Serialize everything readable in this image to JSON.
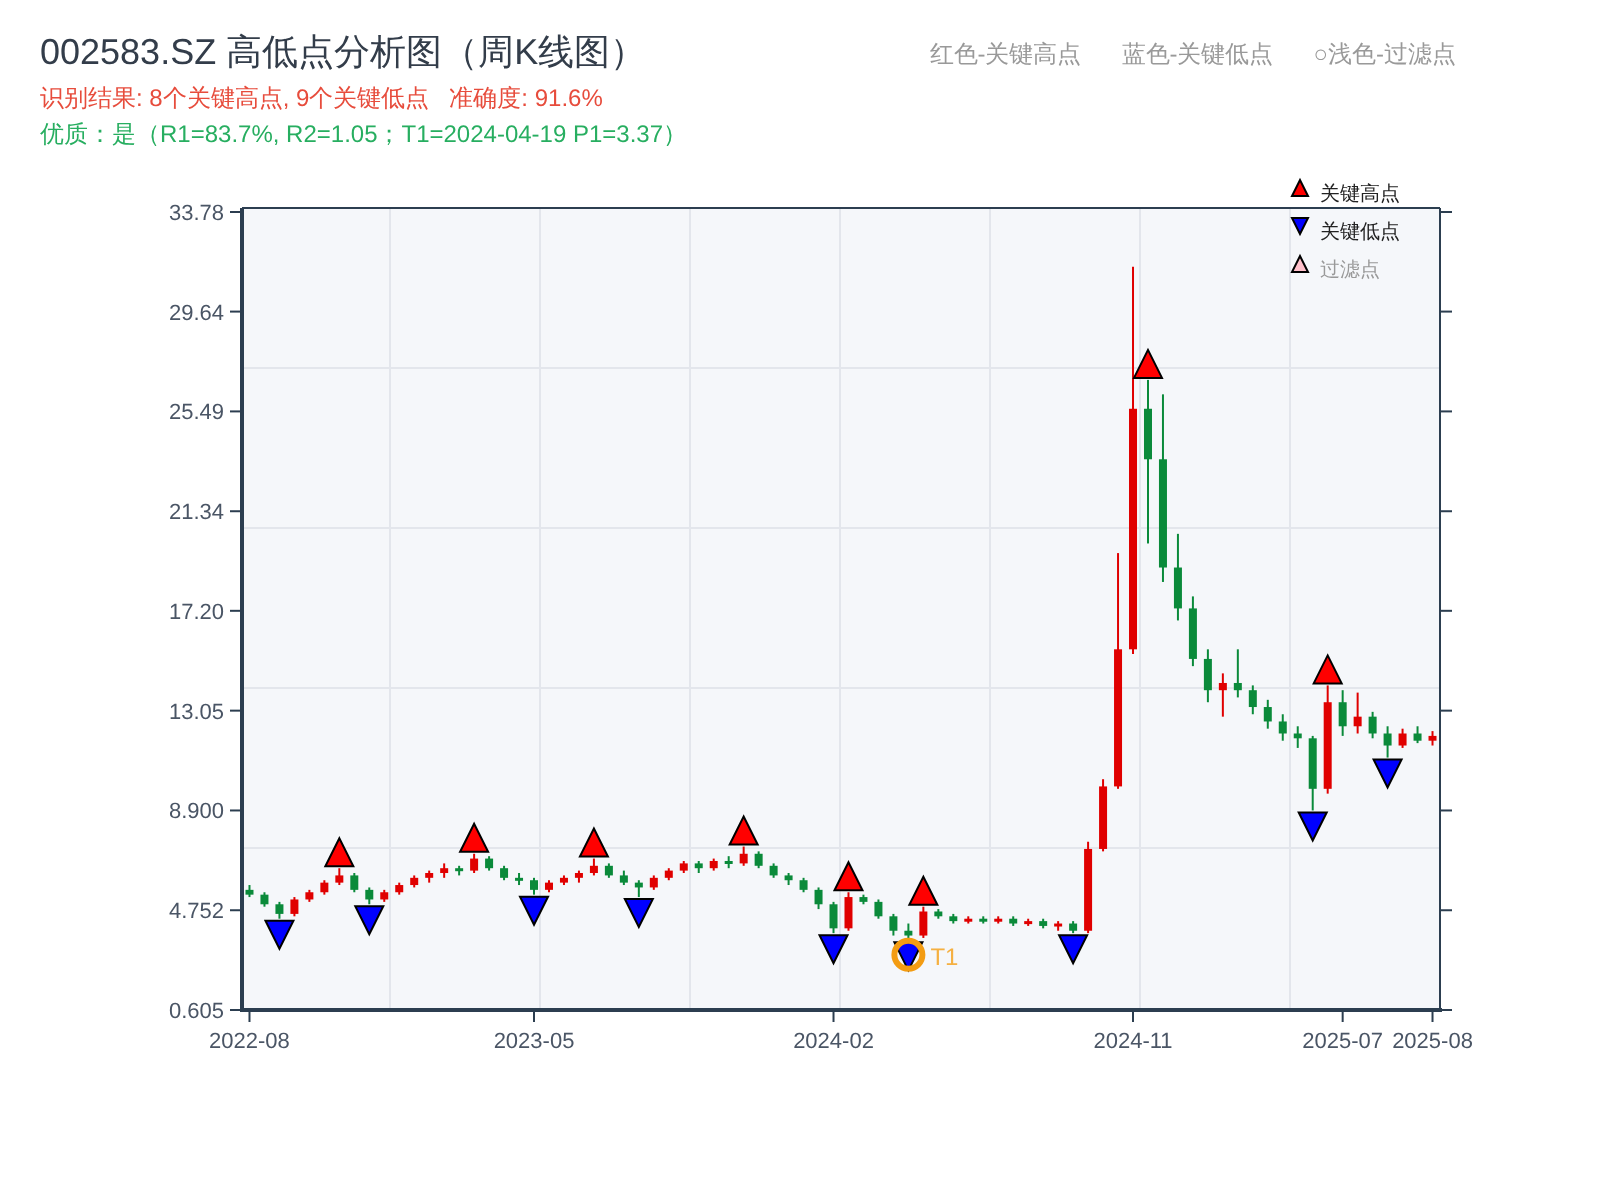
{
  "title": "002583.SZ 高低点分析图（周K线图）",
  "summary": "识别结果: 8个关键高点, 9个关键低点   准确度: 91.6%",
  "quality": "优质：是（R1=83.7%, R2=1.05；T1=2024-04-19 P1=3.37）",
  "color_key": [
    "红色-关键高点",
    "蓝色-关键低点",
    "○浅色-过滤点"
  ],
  "legend": [
    {
      "kind": "high",
      "label": "关键高点"
    },
    {
      "kind": "low",
      "label": "关键低点"
    },
    {
      "kind": "filtered",
      "label": "过滤点"
    }
  ],
  "chart_data": {
    "type": "candlestick",
    "categories": [
      "2022-08",
      null,
      null,
      null,
      null,
      null,
      null,
      null,
      null,
      null,
      null,
      null,
      null,
      null,
      null,
      null,
      null,
      null,
      null,
      "2023-05",
      null,
      null,
      null,
      null,
      null,
      null,
      null,
      null,
      null,
      null,
      null,
      null,
      null,
      null,
      null,
      null,
      null,
      null,
      null,
      "2024-02",
      null,
      null,
      null,
      null,
      null,
      null,
      null,
      null,
      null,
      null,
      null,
      null,
      null,
      null,
      null,
      null,
      null,
      null,
      null,
      "2024-11",
      null,
      null,
      null,
      null,
      null,
      null,
      null,
      null,
      null,
      null,
      null,
      null,
      null,
      "2025-07",
      null,
      null,
      null,
      null,
      null,
      "2025-08"
    ],
    "ohlc": [
      [
        5.6,
        5.8,
        5.3,
        5.4
      ],
      [
        5.4,
        5.5,
        4.9,
        5.0
      ],
      [
        5.0,
        5.1,
        4.4,
        4.6
      ],
      [
        4.6,
        5.3,
        4.5,
        5.2
      ],
      [
        5.2,
        5.6,
        5.1,
        5.5
      ],
      [
        5.5,
        6.0,
        5.4,
        5.9
      ],
      [
        5.9,
        6.5,
        5.8,
        6.2
      ],
      [
        6.2,
        6.3,
        5.5,
        5.6
      ],
      [
        5.6,
        5.7,
        5.0,
        5.2
      ],
      [
        5.2,
        5.6,
        5.1,
        5.5
      ],
      [
        5.5,
        5.9,
        5.4,
        5.8
      ],
      [
        5.8,
        6.2,
        5.7,
        6.1
      ],
      [
        6.1,
        6.4,
        5.9,
        6.3
      ],
      [
        6.3,
        6.7,
        6.1,
        6.5
      ],
      [
        6.5,
        6.6,
        6.2,
        6.4
      ],
      [
        6.4,
        7.1,
        6.3,
        6.9
      ],
      [
        6.9,
        7.0,
        6.4,
        6.5
      ],
      [
        6.5,
        6.6,
        6.0,
        6.1
      ],
      [
        6.1,
        6.3,
        5.8,
        6.0
      ],
      [
        6.0,
        6.1,
        5.4,
        5.6
      ],
      [
        5.6,
        6.0,
        5.5,
        5.9
      ],
      [
        5.9,
        6.2,
        5.8,
        6.1
      ],
      [
        6.1,
        6.4,
        5.9,
        6.3
      ],
      [
        6.3,
        6.9,
        6.2,
        6.6
      ],
      [
        6.6,
        6.7,
        6.1,
        6.2
      ],
      [
        6.2,
        6.4,
        5.8,
        5.9
      ],
      [
        5.9,
        6.0,
        5.3,
        5.7
      ],
      [
        5.7,
        6.2,
        5.6,
        6.1
      ],
      [
        6.1,
        6.5,
        6.0,
        6.4
      ],
      [
        6.4,
        6.8,
        6.3,
        6.7
      ],
      [
        6.7,
        6.8,
        6.3,
        6.5
      ],
      [
        6.5,
        6.9,
        6.4,
        6.8
      ],
      [
        6.8,
        7.0,
        6.5,
        6.7
      ],
      [
        6.7,
        7.4,
        6.6,
        7.1
      ],
      [
        7.1,
        7.2,
        6.5,
        6.6
      ],
      [
        6.6,
        6.7,
        6.1,
        6.2
      ],
      [
        6.2,
        6.3,
        5.8,
        6.0
      ],
      [
        6.0,
        6.1,
        5.5,
        5.6
      ],
      [
        5.6,
        5.7,
        4.8,
        5.0
      ],
      [
        5.0,
        5.1,
        3.8,
        4.0
      ],
      [
        4.0,
        5.5,
        3.9,
        5.3
      ],
      [
        5.3,
        5.4,
        5.0,
        5.1
      ],
      [
        5.1,
        5.2,
        4.4,
        4.5
      ],
      [
        4.5,
        4.6,
        3.7,
        3.9
      ],
      [
        3.9,
        4.2,
        3.5,
        3.7
      ],
      [
        3.7,
        4.9,
        3.6,
        4.7
      ],
      [
        4.7,
        4.8,
        4.4,
        4.5
      ],
      [
        4.5,
        4.6,
        4.2,
        4.3
      ],
      [
        4.3,
        4.5,
        4.2,
        4.4
      ],
      [
        4.4,
        4.5,
        4.2,
        4.3
      ],
      [
        4.3,
        4.5,
        4.2,
        4.4
      ],
      [
        4.4,
        4.5,
        4.1,
        4.2
      ],
      [
        4.2,
        4.4,
        4.1,
        4.3
      ],
      [
        4.3,
        4.4,
        4.0,
        4.1
      ],
      [
        4.1,
        4.3,
        3.9,
        4.2
      ],
      [
        4.2,
        4.3,
        3.8,
        3.9
      ],
      [
        3.9,
        7.6,
        3.8,
        7.3
      ],
      [
        7.3,
        10.2,
        7.2,
        9.9
      ],
      [
        9.9,
        19.6,
        9.8,
        15.6
      ],
      [
        15.6,
        31.5,
        15.4,
        25.6
      ],
      [
        25.6,
        26.8,
        20.0,
        23.5
      ],
      [
        23.5,
        26.2,
        18.4,
        19.0
      ],
      [
        19.0,
        20.4,
        16.8,
        17.3
      ],
      [
        17.3,
        17.8,
        14.9,
        15.2
      ],
      [
        15.2,
        15.6,
        13.4,
        13.9
      ],
      [
        13.9,
        14.6,
        12.8,
        14.2
      ],
      [
        14.2,
        15.6,
        13.6,
        13.9
      ],
      [
        13.9,
        14.1,
        12.9,
        13.2
      ],
      [
        13.2,
        13.5,
        12.3,
        12.6
      ],
      [
        12.6,
        12.9,
        11.8,
        12.1
      ],
      [
        12.1,
        12.4,
        11.5,
        11.9
      ],
      [
        11.9,
        12.0,
        8.9,
        9.8
      ],
      [
        9.8,
        14.1,
        9.6,
        13.4
      ],
      [
        13.4,
        13.9,
        12.0,
        12.4
      ],
      [
        12.4,
        13.8,
        12.1,
        12.8
      ],
      [
        12.8,
        13.0,
        11.9,
        12.1
      ],
      [
        12.1,
        12.4,
        11.1,
        11.6
      ],
      [
        11.6,
        12.3,
        11.5,
        12.1
      ],
      [
        12.1,
        12.4,
        11.7,
        11.8
      ],
      [
        11.8,
        12.2,
        11.6,
        12.0
      ]
    ],
    "ylim": [
      0.605,
      33.78
    ],
    "yticks": [
      {
        "value": 33.78,
        "label": "33.78"
      },
      {
        "value": 29.64,
        "label": "29.64"
      },
      {
        "value": 25.49,
        "label": "25.49"
      },
      {
        "value": 21.34,
        "label": "21.34"
      },
      {
        "value": 17.2,
        "label": "17.20"
      },
      {
        "value": 13.05,
        "label": "13.05"
      },
      {
        "value": 8.9,
        "label": "8.900"
      },
      {
        "value": 4.752,
        "label": "4.752"
      },
      {
        "value": 0.605,
        "label": "0.605"
      }
    ],
    "annotations": [
      {
        "text": "T1"
      }
    ]
  }
}
